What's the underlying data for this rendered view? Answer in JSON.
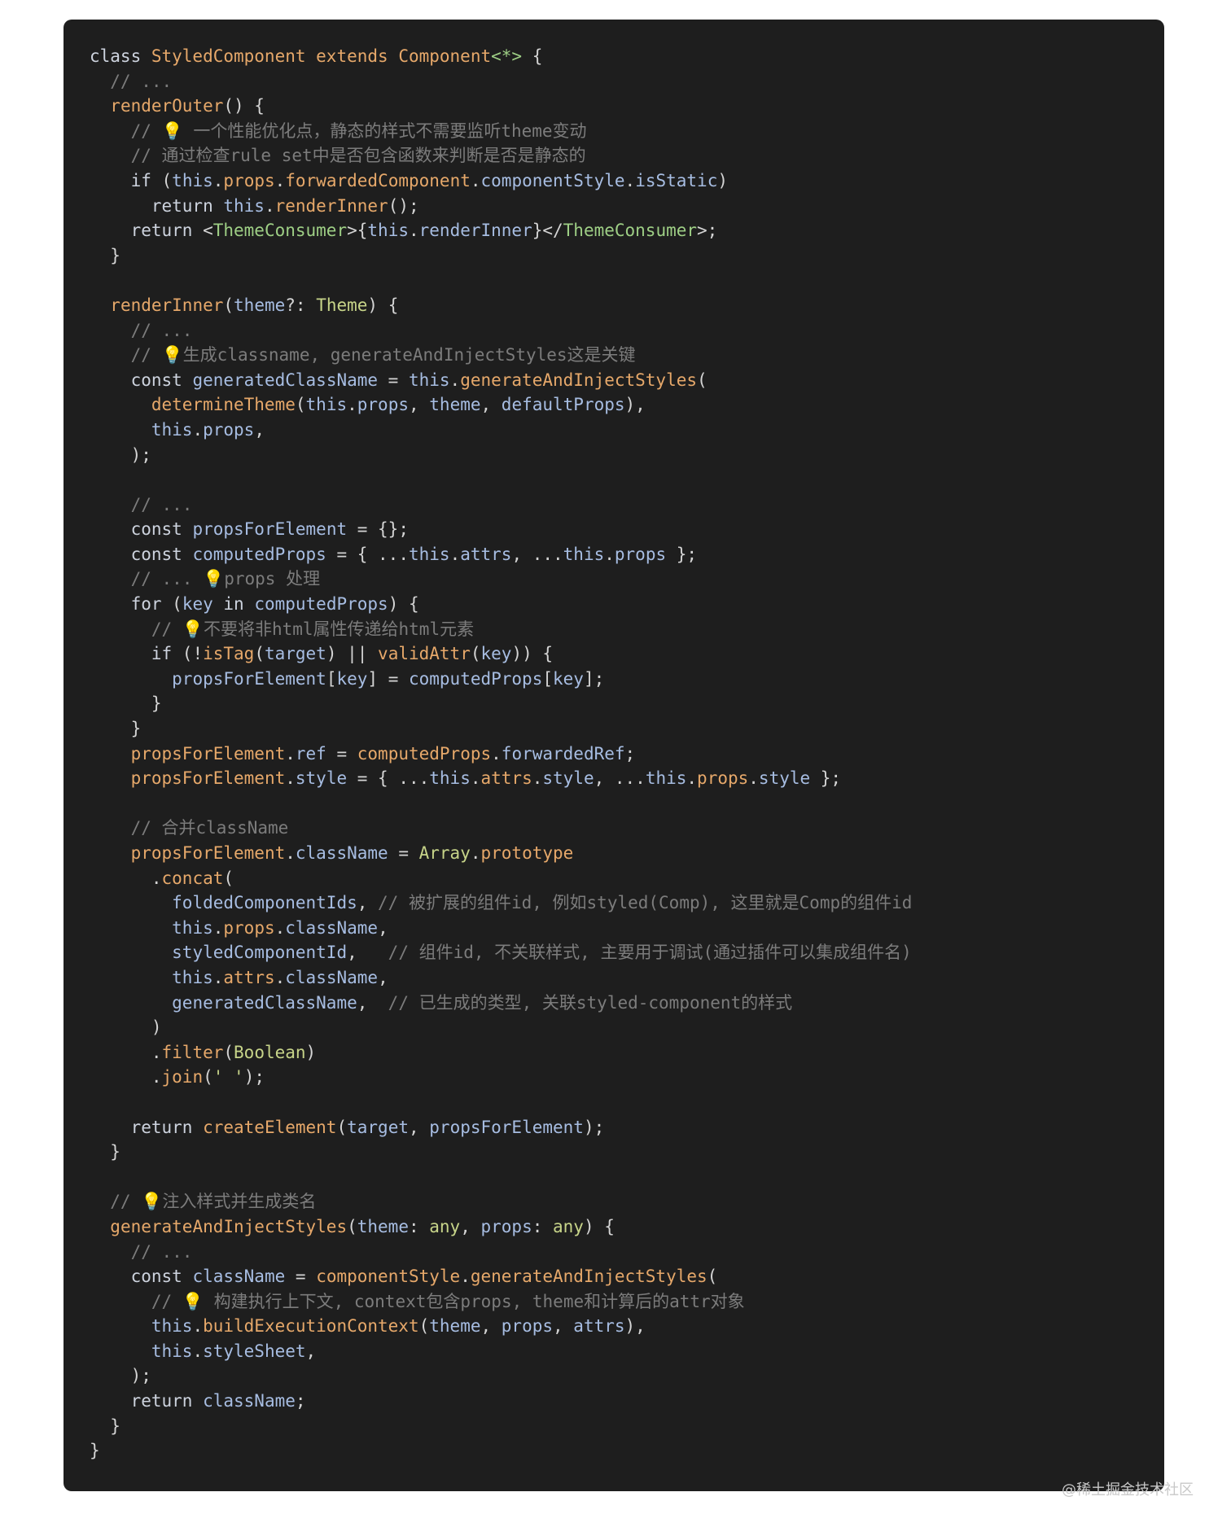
{
  "code": {
    "lines": [
      [
        [
          "class ",
          "kw2"
        ],
        [
          "StyledComponent",
          "fn"
        ],
        [
          " extends ",
          "kw"
        ],
        [
          "Component",
          "fn"
        ],
        [
          "<*>",
          "tag"
        ],
        [
          " {",
          "pn"
        ]
      ],
      [
        [
          "  // ...",
          "cm"
        ]
      ],
      [
        [
          "  ",
          "pn"
        ],
        [
          "renderOuter",
          "fn"
        ],
        [
          "() {",
          "pn"
        ]
      ],
      [
        [
          "    // ",
          "cm"
        ],
        [
          "💡",
          "bulb"
        ],
        [
          " 一个性能优化点，静态的样式不需要监听theme变动",
          "cm"
        ]
      ],
      [
        [
          "    // 通过检查rule set中是否包含函数来判断是否是静态的",
          "cm"
        ]
      ],
      [
        [
          "    ",
          "pn"
        ],
        [
          "if",
          "kw2"
        ],
        [
          " (",
          "pn"
        ],
        [
          "this",
          "var"
        ],
        [
          ".",
          "pn"
        ],
        [
          "props",
          "prop"
        ],
        [
          ".",
          "pn"
        ],
        [
          "forwardedComponent",
          "prop"
        ],
        [
          ".",
          "pn"
        ],
        [
          "componentStyle",
          "var"
        ],
        [
          ".",
          "pn"
        ],
        [
          "isStatic",
          "var"
        ],
        [
          ")",
          "pn"
        ]
      ],
      [
        [
          "      ",
          "pn"
        ],
        [
          "return",
          "kw2"
        ],
        [
          " ",
          "pn"
        ],
        [
          "this",
          "var"
        ],
        [
          ".",
          "pn"
        ],
        [
          "renderInner",
          "fn"
        ],
        [
          "();",
          "pn"
        ]
      ],
      [
        [
          "    ",
          "pn"
        ],
        [
          "return",
          "kw2"
        ],
        [
          " <",
          "pn"
        ],
        [
          "ThemeConsumer",
          "tag"
        ],
        [
          ">{",
          "pn"
        ],
        [
          "this",
          "var"
        ],
        [
          ".",
          "pn"
        ],
        [
          "renderInner",
          "var"
        ],
        [
          "}</",
          "pn"
        ],
        [
          "ThemeConsumer",
          "tag"
        ],
        [
          ">;",
          "pn"
        ]
      ],
      [
        [
          "  }",
          "pn"
        ]
      ],
      [
        [
          "",
          "pn"
        ]
      ],
      [
        [
          "  ",
          "pn"
        ],
        [
          "renderInner",
          "fn"
        ],
        [
          "(",
          "pn"
        ],
        [
          "theme",
          "var"
        ],
        [
          "?: ",
          "pn"
        ],
        [
          "Theme",
          "cls"
        ],
        [
          ") {",
          "pn"
        ]
      ],
      [
        [
          "    // ...",
          "cm"
        ]
      ],
      [
        [
          "    // ",
          "cm"
        ],
        [
          "💡",
          "bulb"
        ],
        [
          "生成classname, generateAndInjectStyles这是关键",
          "cm"
        ]
      ],
      [
        [
          "    ",
          "pn"
        ],
        [
          "const",
          "kw2"
        ],
        [
          " ",
          "pn"
        ],
        [
          "generatedClassName",
          "var"
        ],
        [
          " = ",
          "pn"
        ],
        [
          "this",
          "var"
        ],
        [
          ".",
          "pn"
        ],
        [
          "generateAndInjectStyles",
          "fn"
        ],
        [
          "(",
          "pn"
        ]
      ],
      [
        [
          "      ",
          "pn"
        ],
        [
          "determineTheme",
          "fn"
        ],
        [
          "(",
          "pn"
        ],
        [
          "this",
          "var"
        ],
        [
          ".",
          "pn"
        ],
        [
          "props",
          "var"
        ],
        [
          ", ",
          "pn"
        ],
        [
          "theme",
          "var"
        ],
        [
          ", ",
          "pn"
        ],
        [
          "defaultProps",
          "var"
        ],
        [
          "),",
          "pn"
        ]
      ],
      [
        [
          "      ",
          "pn"
        ],
        [
          "this",
          "var"
        ],
        [
          ".",
          "pn"
        ],
        [
          "props",
          "var"
        ],
        [
          ",",
          "pn"
        ]
      ],
      [
        [
          "    );",
          "pn"
        ]
      ],
      [
        [
          "",
          "pn"
        ]
      ],
      [
        [
          "    // ...",
          "cm"
        ]
      ],
      [
        [
          "    ",
          "pn"
        ],
        [
          "const",
          "kw2"
        ],
        [
          " ",
          "pn"
        ],
        [
          "propsForElement",
          "var"
        ],
        [
          " = {};",
          "pn"
        ]
      ],
      [
        [
          "    ",
          "pn"
        ],
        [
          "const",
          "kw2"
        ],
        [
          " ",
          "pn"
        ],
        [
          "computedProps",
          "var"
        ],
        [
          " = { ...",
          "pn"
        ],
        [
          "this",
          "var"
        ],
        [
          ".",
          "pn"
        ],
        [
          "attrs",
          "var"
        ],
        [
          ", ...",
          "pn"
        ],
        [
          "this",
          "var"
        ],
        [
          ".",
          "pn"
        ],
        [
          "props",
          "var"
        ],
        [
          " };",
          "pn"
        ]
      ],
      [
        [
          "    // ... ",
          "cm"
        ],
        [
          "💡",
          "bulb"
        ],
        [
          "props 处理",
          "cm"
        ]
      ],
      [
        [
          "    ",
          "pn"
        ],
        [
          "for",
          "kw2"
        ],
        [
          " (",
          "pn"
        ],
        [
          "key",
          "var"
        ],
        [
          " in ",
          "kw2"
        ],
        [
          "computedProps",
          "var"
        ],
        [
          ") {",
          "pn"
        ]
      ],
      [
        [
          "      // ",
          "cm"
        ],
        [
          "💡",
          "bulb"
        ],
        [
          "不要将非html属性传递给html元素",
          "cm"
        ]
      ],
      [
        [
          "      ",
          "pn"
        ],
        [
          "if",
          "kw2"
        ],
        [
          " (!",
          "pn"
        ],
        [
          "isTag",
          "fn"
        ],
        [
          "(",
          "pn"
        ],
        [
          "target",
          "var"
        ],
        [
          ") || ",
          "pn"
        ],
        [
          "validAttr",
          "fn"
        ],
        [
          "(",
          "pn"
        ],
        [
          "key",
          "var"
        ],
        [
          ")) {",
          "pn"
        ]
      ],
      [
        [
          "        ",
          "pn"
        ],
        [
          "propsForElement",
          "var"
        ],
        [
          "[",
          "pn"
        ],
        [
          "key",
          "var"
        ],
        [
          "] = ",
          "pn"
        ],
        [
          "computedProps",
          "var"
        ],
        [
          "[",
          "pn"
        ],
        [
          "key",
          "var"
        ],
        [
          "];",
          "pn"
        ]
      ],
      [
        [
          "      }",
          "pn"
        ]
      ],
      [
        [
          "    }",
          "pn"
        ]
      ],
      [
        [
          "    ",
          "pn"
        ],
        [
          "propsForElement",
          "prop"
        ],
        [
          ".",
          "pn"
        ],
        [
          "ref",
          "var"
        ],
        [
          " = ",
          "pn"
        ],
        [
          "computedProps",
          "prop"
        ],
        [
          ".",
          "pn"
        ],
        [
          "forwardedRef",
          "var"
        ],
        [
          ";",
          "pn"
        ]
      ],
      [
        [
          "    ",
          "pn"
        ],
        [
          "propsForElement",
          "prop"
        ],
        [
          ".",
          "pn"
        ],
        [
          "style",
          "var"
        ],
        [
          " = { ...",
          "pn"
        ],
        [
          "this",
          "var"
        ],
        [
          ".",
          "pn"
        ],
        [
          "attrs",
          "prop"
        ],
        [
          ".",
          "pn"
        ],
        [
          "style",
          "var"
        ],
        [
          ", ...",
          "pn"
        ],
        [
          "this",
          "var"
        ],
        [
          ".",
          "pn"
        ],
        [
          "props",
          "prop"
        ],
        [
          ".",
          "pn"
        ],
        [
          "style",
          "var"
        ],
        [
          " };",
          "pn"
        ]
      ],
      [
        [
          "",
          "pn"
        ]
      ],
      [
        [
          "    // 合并className",
          "cm"
        ]
      ],
      [
        [
          "    ",
          "pn"
        ],
        [
          "propsForElement",
          "prop"
        ],
        [
          ".",
          "pn"
        ],
        [
          "className",
          "var"
        ],
        [
          " = ",
          "pn"
        ],
        [
          "Array",
          "cls"
        ],
        [
          ".",
          "pn"
        ],
        [
          "prototype",
          "prop"
        ]
      ],
      [
        [
          "      .",
          "pn"
        ],
        [
          "concat",
          "fn"
        ],
        [
          "(",
          "pn"
        ]
      ],
      [
        [
          "        ",
          "pn"
        ],
        [
          "foldedComponentIds",
          "var"
        ],
        [
          ", ",
          "pn"
        ],
        [
          "// 被扩展的组件id, 例如styled(Comp), 这里就是Comp的组件id",
          "cm"
        ]
      ],
      [
        [
          "        ",
          "pn"
        ],
        [
          "this",
          "var"
        ],
        [
          ".",
          "pn"
        ],
        [
          "props",
          "prop"
        ],
        [
          ".",
          "pn"
        ],
        [
          "className",
          "var"
        ],
        [
          ",",
          "pn"
        ]
      ],
      [
        [
          "        ",
          "pn"
        ],
        [
          "styledComponentId",
          "var"
        ],
        [
          ",   ",
          "pn"
        ],
        [
          "// 组件id, 不关联样式, 主要用于调试(通过插件可以集成组件名)",
          "cm"
        ]
      ],
      [
        [
          "        ",
          "pn"
        ],
        [
          "this",
          "var"
        ],
        [
          ".",
          "pn"
        ],
        [
          "attrs",
          "prop"
        ],
        [
          ".",
          "pn"
        ],
        [
          "className",
          "var"
        ],
        [
          ",",
          "pn"
        ]
      ],
      [
        [
          "        ",
          "pn"
        ],
        [
          "generatedClassName",
          "var"
        ],
        [
          ",  ",
          "pn"
        ],
        [
          "// 已生成的类型, 关联styled-component的样式",
          "cm"
        ]
      ],
      [
        [
          "      )",
          "pn"
        ]
      ],
      [
        [
          "      .",
          "pn"
        ],
        [
          "filter",
          "fn"
        ],
        [
          "(",
          "pn"
        ],
        [
          "Boolean",
          "cls"
        ],
        [
          ")",
          "pn"
        ]
      ],
      [
        [
          "      .",
          "pn"
        ],
        [
          "join",
          "fn"
        ],
        [
          "(",
          "pn"
        ],
        [
          "' '",
          "str"
        ],
        [
          ");",
          "pn"
        ]
      ],
      [
        [
          "",
          "pn"
        ]
      ],
      [
        [
          "    ",
          "pn"
        ],
        [
          "return",
          "kw2"
        ],
        [
          " ",
          "pn"
        ],
        [
          "createElement",
          "fn"
        ],
        [
          "(",
          "pn"
        ],
        [
          "target",
          "var"
        ],
        [
          ", ",
          "pn"
        ],
        [
          "propsForElement",
          "var"
        ],
        [
          ");",
          "pn"
        ]
      ],
      [
        [
          "  }",
          "pn"
        ]
      ],
      [
        [
          "",
          "pn"
        ]
      ],
      [
        [
          "  // ",
          "cm"
        ],
        [
          "💡",
          "bulb"
        ],
        [
          "注入样式并生成类名",
          "cm"
        ]
      ],
      [
        [
          "  ",
          "pn"
        ],
        [
          "generateAndInjectStyles",
          "fn"
        ],
        [
          "(",
          "pn"
        ],
        [
          "theme",
          "var"
        ],
        [
          ": ",
          "pn"
        ],
        [
          "any",
          "cls"
        ],
        [
          ", ",
          "pn"
        ],
        [
          "props",
          "var"
        ],
        [
          ": ",
          "pn"
        ],
        [
          "any",
          "cls"
        ],
        [
          ") {",
          "pn"
        ]
      ],
      [
        [
          "    // ...",
          "cm"
        ]
      ],
      [
        [
          "    ",
          "pn"
        ],
        [
          "const",
          "kw2"
        ],
        [
          " ",
          "pn"
        ],
        [
          "className",
          "var"
        ],
        [
          " = ",
          "pn"
        ],
        [
          "componentStyle",
          "prop"
        ],
        [
          ".",
          "pn"
        ],
        [
          "generateAndInjectStyles",
          "fn"
        ],
        [
          "(",
          "pn"
        ]
      ],
      [
        [
          "      // ",
          "cm"
        ],
        [
          "💡",
          "bulb"
        ],
        [
          " 构建执行上下文, context包含props, theme和计算后的attr对象",
          "cm"
        ]
      ],
      [
        [
          "      ",
          "pn"
        ],
        [
          "this",
          "var"
        ],
        [
          ".",
          "pn"
        ],
        [
          "buildExecutionContext",
          "fn"
        ],
        [
          "(",
          "pn"
        ],
        [
          "theme",
          "var"
        ],
        [
          ", ",
          "pn"
        ],
        [
          "props",
          "var"
        ],
        [
          ", ",
          "pn"
        ],
        [
          "attrs",
          "var"
        ],
        [
          "),",
          "pn"
        ]
      ],
      [
        [
          "      ",
          "pn"
        ],
        [
          "this",
          "var"
        ],
        [
          ".",
          "pn"
        ],
        [
          "styleSheet",
          "var"
        ],
        [
          ",",
          "pn"
        ]
      ],
      [
        [
          "    );",
          "pn"
        ]
      ],
      [
        [
          "    ",
          "pn"
        ],
        [
          "return",
          "kw2"
        ],
        [
          " ",
          "pn"
        ],
        [
          "className",
          "var"
        ],
        [
          ";",
          "pn"
        ]
      ],
      [
        [
          "  }",
          "pn"
        ]
      ],
      [
        [
          "}",
          "pn"
        ]
      ]
    ]
  },
  "watermark": "@稀土掘金技术社区"
}
